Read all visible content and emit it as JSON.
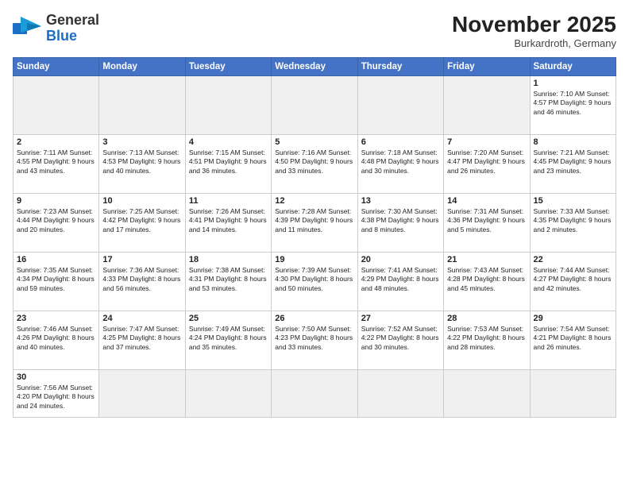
{
  "header": {
    "logo_general": "General",
    "logo_blue": "Blue",
    "month_title": "November 2025",
    "location": "Burkardroth, Germany"
  },
  "days_of_week": [
    "Sunday",
    "Monday",
    "Tuesday",
    "Wednesday",
    "Thursday",
    "Friday",
    "Saturday"
  ],
  "weeks": [
    [
      {
        "day": "",
        "info": ""
      },
      {
        "day": "",
        "info": ""
      },
      {
        "day": "",
        "info": ""
      },
      {
        "day": "",
        "info": ""
      },
      {
        "day": "",
        "info": ""
      },
      {
        "day": "",
        "info": ""
      },
      {
        "day": "1",
        "info": "Sunrise: 7:10 AM\nSunset: 4:57 PM\nDaylight: 9 hours and 46 minutes."
      }
    ],
    [
      {
        "day": "2",
        "info": "Sunrise: 7:11 AM\nSunset: 4:55 PM\nDaylight: 9 hours and 43 minutes."
      },
      {
        "day": "3",
        "info": "Sunrise: 7:13 AM\nSunset: 4:53 PM\nDaylight: 9 hours and 40 minutes."
      },
      {
        "day": "4",
        "info": "Sunrise: 7:15 AM\nSunset: 4:51 PM\nDaylight: 9 hours and 36 minutes."
      },
      {
        "day": "5",
        "info": "Sunrise: 7:16 AM\nSunset: 4:50 PM\nDaylight: 9 hours and 33 minutes."
      },
      {
        "day": "6",
        "info": "Sunrise: 7:18 AM\nSunset: 4:48 PM\nDaylight: 9 hours and 30 minutes."
      },
      {
        "day": "7",
        "info": "Sunrise: 7:20 AM\nSunset: 4:47 PM\nDaylight: 9 hours and 26 minutes."
      },
      {
        "day": "8",
        "info": "Sunrise: 7:21 AM\nSunset: 4:45 PM\nDaylight: 9 hours and 23 minutes."
      }
    ],
    [
      {
        "day": "9",
        "info": "Sunrise: 7:23 AM\nSunset: 4:44 PM\nDaylight: 9 hours and 20 minutes."
      },
      {
        "day": "10",
        "info": "Sunrise: 7:25 AM\nSunset: 4:42 PM\nDaylight: 9 hours and 17 minutes."
      },
      {
        "day": "11",
        "info": "Sunrise: 7:26 AM\nSunset: 4:41 PM\nDaylight: 9 hours and 14 minutes."
      },
      {
        "day": "12",
        "info": "Sunrise: 7:28 AM\nSunset: 4:39 PM\nDaylight: 9 hours and 11 minutes."
      },
      {
        "day": "13",
        "info": "Sunrise: 7:30 AM\nSunset: 4:38 PM\nDaylight: 9 hours and 8 minutes."
      },
      {
        "day": "14",
        "info": "Sunrise: 7:31 AM\nSunset: 4:36 PM\nDaylight: 9 hours and 5 minutes."
      },
      {
        "day": "15",
        "info": "Sunrise: 7:33 AM\nSunset: 4:35 PM\nDaylight: 9 hours and 2 minutes."
      }
    ],
    [
      {
        "day": "16",
        "info": "Sunrise: 7:35 AM\nSunset: 4:34 PM\nDaylight: 8 hours and 59 minutes."
      },
      {
        "day": "17",
        "info": "Sunrise: 7:36 AM\nSunset: 4:33 PM\nDaylight: 8 hours and 56 minutes."
      },
      {
        "day": "18",
        "info": "Sunrise: 7:38 AM\nSunset: 4:31 PM\nDaylight: 8 hours and 53 minutes."
      },
      {
        "day": "19",
        "info": "Sunrise: 7:39 AM\nSunset: 4:30 PM\nDaylight: 8 hours and 50 minutes."
      },
      {
        "day": "20",
        "info": "Sunrise: 7:41 AM\nSunset: 4:29 PM\nDaylight: 8 hours and 48 minutes."
      },
      {
        "day": "21",
        "info": "Sunrise: 7:43 AM\nSunset: 4:28 PM\nDaylight: 8 hours and 45 minutes."
      },
      {
        "day": "22",
        "info": "Sunrise: 7:44 AM\nSunset: 4:27 PM\nDaylight: 8 hours and 42 minutes."
      }
    ],
    [
      {
        "day": "23",
        "info": "Sunrise: 7:46 AM\nSunset: 4:26 PM\nDaylight: 8 hours and 40 minutes."
      },
      {
        "day": "24",
        "info": "Sunrise: 7:47 AM\nSunset: 4:25 PM\nDaylight: 8 hours and 37 minutes."
      },
      {
        "day": "25",
        "info": "Sunrise: 7:49 AM\nSunset: 4:24 PM\nDaylight: 8 hours and 35 minutes."
      },
      {
        "day": "26",
        "info": "Sunrise: 7:50 AM\nSunset: 4:23 PM\nDaylight: 8 hours and 33 minutes."
      },
      {
        "day": "27",
        "info": "Sunrise: 7:52 AM\nSunset: 4:22 PM\nDaylight: 8 hours and 30 minutes."
      },
      {
        "day": "28",
        "info": "Sunrise: 7:53 AM\nSunset: 4:22 PM\nDaylight: 8 hours and 28 minutes."
      },
      {
        "day": "29",
        "info": "Sunrise: 7:54 AM\nSunset: 4:21 PM\nDaylight: 8 hours and 26 minutes."
      }
    ],
    [
      {
        "day": "30",
        "info": "Sunrise: 7:56 AM\nSunset: 4:20 PM\nDaylight: 8 hours and 24 minutes."
      },
      {
        "day": "",
        "info": ""
      },
      {
        "day": "",
        "info": ""
      },
      {
        "day": "",
        "info": ""
      },
      {
        "day": "",
        "info": ""
      },
      {
        "day": "",
        "info": ""
      },
      {
        "day": "",
        "info": ""
      }
    ]
  ]
}
